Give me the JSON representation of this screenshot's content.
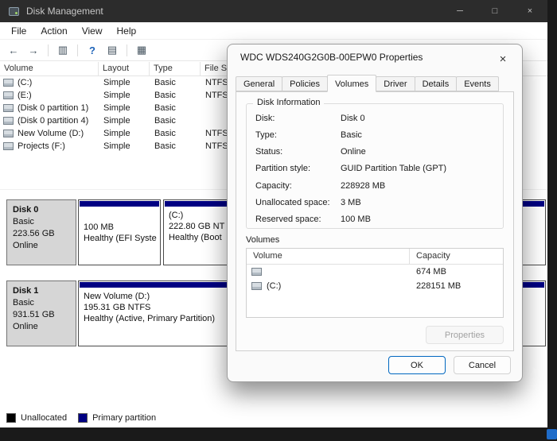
{
  "desktop": {
    "taskbar_icon_color": "#1f6cc9"
  },
  "window": {
    "title": "Disk Management",
    "controls": {
      "minimize": "─",
      "maximize": "□",
      "close": "×"
    }
  },
  "menu": {
    "items": [
      "File",
      "Action",
      "View",
      "Help"
    ]
  },
  "toolbar": {
    "icons": [
      {
        "name": "back",
        "glyph": "←"
      },
      {
        "name": "forward",
        "glyph": "→"
      },
      {
        "name": "console-tree",
        "glyph": "▥"
      },
      {
        "name": "help",
        "glyph": "?"
      },
      {
        "name": "action-pane",
        "glyph": "▤"
      },
      {
        "name": "disk-view",
        "glyph": "▦"
      }
    ]
  },
  "volume_table": {
    "columns": [
      "Volume",
      "Layout",
      "Type",
      "File S"
    ],
    "rows": [
      {
        "volume": "(C:)",
        "layout": "Simple",
        "type": "Basic",
        "fs": "NTFS"
      },
      {
        "volume": "(E:)",
        "layout": "Simple",
        "type": "Basic",
        "fs": "NTFS"
      },
      {
        "volume": "(Disk 0 partition 1)",
        "layout": "Simple",
        "type": "Basic",
        "fs": ""
      },
      {
        "volume": "(Disk 0 partition 4)",
        "layout": "Simple",
        "type": "Basic",
        "fs": ""
      },
      {
        "volume": "New Volume (D:)",
        "layout": "Simple",
        "type": "Basic",
        "fs": "NTFS"
      },
      {
        "volume": "Projects (F:)",
        "layout": "Simple",
        "type": "Basic",
        "fs": "NTFS"
      }
    ]
  },
  "disk_pane": {
    "disks": [
      {
        "name": "Disk 0",
        "type": "Basic",
        "size": "223.56 GB",
        "status": "Online",
        "partitions": [
          {
            "name": "",
            "size": "100 MB",
            "status": "Healthy (EFI Syste"
          },
          {
            "name": "(C:)",
            "size": "222.80 GB NT",
            "status": "Healthy (Boot"
          }
        ]
      },
      {
        "name": "Disk 1",
        "type": "Basic",
        "size": "931.51 GB",
        "status": "Online",
        "partitions": [
          {
            "name": "New Volume (D:)",
            "size": "195.31 GB NTFS",
            "status": "Healthy (Active, Primary Partition)"
          }
        ]
      }
    ]
  },
  "legend": {
    "items": [
      {
        "label": "Unallocated",
        "color": "#000000"
      },
      {
        "label": "Primary partition",
        "color": "#000082"
      }
    ]
  },
  "dialog": {
    "title": "WDC WDS240G2G0B-00EPW0 Properties",
    "close_glyph": "×",
    "accent": "#0067c0",
    "tabs": [
      "General",
      "Policies",
      "Volumes",
      "Driver",
      "Details",
      "Events"
    ],
    "active_tab": "Volumes",
    "disk_info": {
      "heading": "Disk Information",
      "fields": [
        {
          "label": "Disk:",
          "value": "Disk 0"
        },
        {
          "label": "Type:",
          "value": "Basic"
        },
        {
          "label": "Status:",
          "value": "Online"
        },
        {
          "label": "Partition style:",
          "value": "GUID Partition Table (GPT)"
        },
        {
          "label": "Capacity:",
          "value": "228928 MB"
        },
        {
          "label": "Unallocated space:",
          "value": "3 MB"
        },
        {
          "label": "Reserved space:",
          "value": "100 MB"
        }
      ]
    },
    "volumes": {
      "heading": "Volumes",
      "columns": [
        "Volume",
        "Capacity"
      ],
      "rows": [
        {
          "volume": "",
          "capacity": "674 MB"
        },
        {
          "volume": "(C:)",
          "capacity": "228151 MB"
        }
      ]
    },
    "properties_button": "Properties",
    "ok": "OK",
    "cancel": "Cancel"
  }
}
